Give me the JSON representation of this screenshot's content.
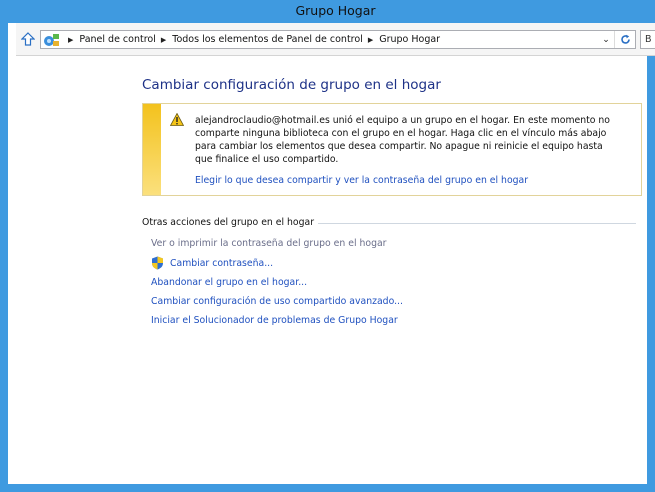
{
  "window": {
    "title": "Grupo Hogar"
  },
  "address": {
    "crumbs": [
      "Panel de control",
      "Todos los elementos de Panel de control",
      "Grupo Hogar"
    ],
    "search_placeholder": "B"
  },
  "page": {
    "title": "Cambiar configuración de grupo en el hogar",
    "notice": {
      "text": "alejandroclaudio@hotmail.es unió el equipo a un grupo en el hogar. En este momento no comparte ninguna biblioteca con el grupo en el hogar. Haga clic en el vínculo más abajo para cambiar los elementos que desea compartir. No apague ni reinicie el equipo hasta que finalice el uso compartido.",
      "link": "Elegir lo que desea compartir y ver la contraseña del grupo en el hogar"
    },
    "section_title": "Otras acciones del grupo en el hogar",
    "tasks": [
      {
        "label": "Ver o imprimir la contraseña del grupo en el hogar",
        "enabled": false,
        "icon": ""
      },
      {
        "label": "Cambiar contraseña...",
        "enabled": true,
        "icon": "uac-shield-icon"
      },
      {
        "label": "Abandonar el grupo en el hogar...",
        "enabled": true,
        "icon": ""
      },
      {
        "label": "Cambiar configuración de uso compartido avanzado...",
        "enabled": true,
        "icon": ""
      },
      {
        "label": "Iniciar el Solucionador de problemas de Grupo Hogar",
        "enabled": true,
        "icon": ""
      }
    ]
  },
  "colors": {
    "title_bar": "#3f9ae0",
    "link": "#1f50bf",
    "heading": "#1e3287",
    "warning_bar": "#f3c21d"
  }
}
